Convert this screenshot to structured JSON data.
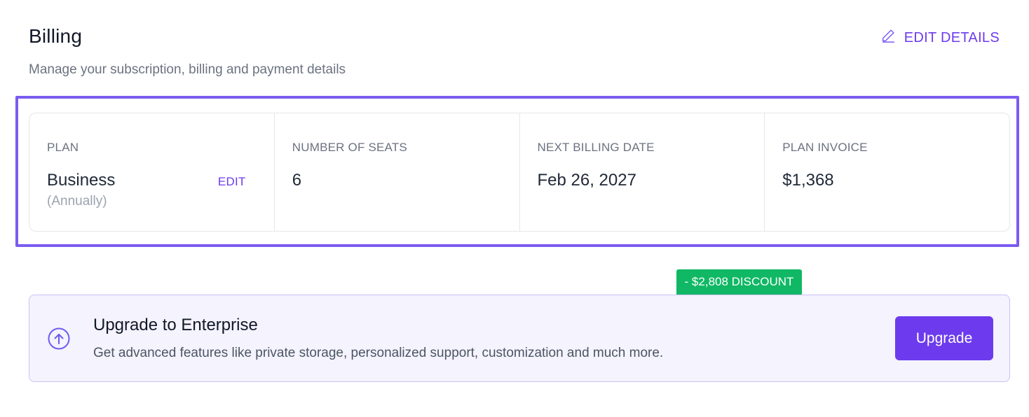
{
  "header": {
    "title": "Billing",
    "subtitle": "Manage your subscription, billing and payment details",
    "edit_details_label": "EDIT DETAILS"
  },
  "stats": {
    "plan": {
      "label": "PLAN",
      "value": "Business",
      "sub": "(Annually)",
      "edit_label": "EDIT"
    },
    "seats": {
      "label": "NUMBER OF SEATS",
      "value": "6"
    },
    "next_billing": {
      "label": "NEXT BILLING DATE",
      "value": "Feb 26, 2027"
    },
    "invoice": {
      "label": "PLAN INVOICE",
      "value": "$1,368"
    }
  },
  "upgrade": {
    "discount_badge": "- $2,808 DISCOUNT",
    "title": "Upgrade to Enterprise",
    "description": "Get advanced features like private storage, personalized support, customization and much more.",
    "button_label": "Upgrade",
    "icon": "arrow-up-circle-icon"
  },
  "colors": {
    "accent": "#6d3bed",
    "highlight": "#7b5cf0",
    "discount": "#10b865",
    "banner_bg": "#f4f3fe"
  }
}
